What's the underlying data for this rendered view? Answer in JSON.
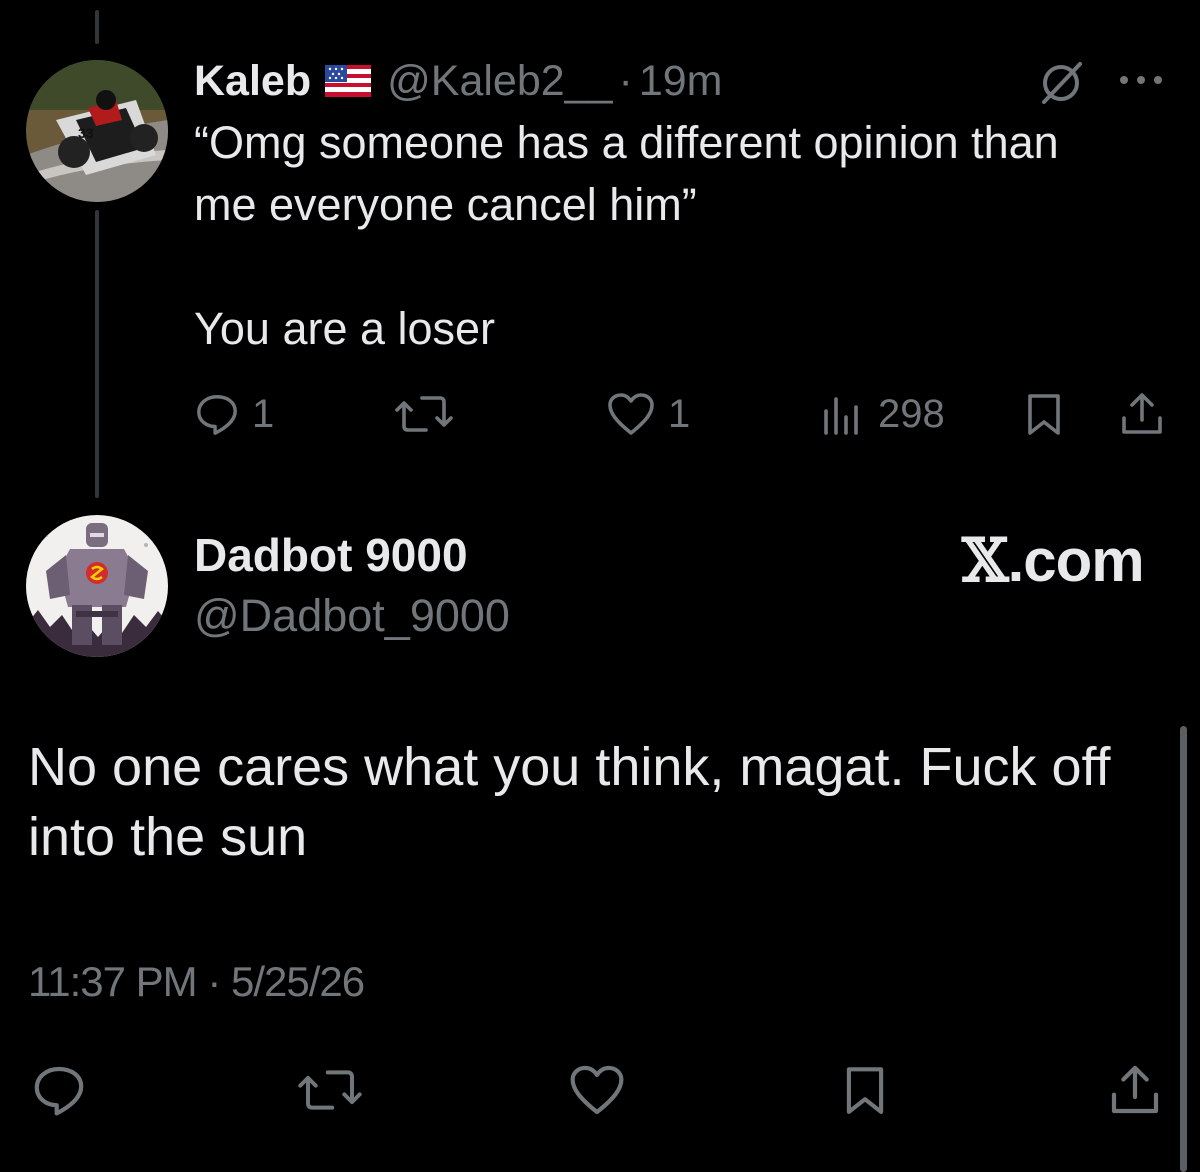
{
  "reply": {
    "author_name": "Kaleb",
    "flag_icon": "us-flag-icon",
    "handle": "@Kaleb2__",
    "separator": "·",
    "time": "19m",
    "text": "“Omg someone has a different opinion than\nme everyone cancel him”\n\nYou are a loser",
    "stats": {
      "replies": "1",
      "likes": "1",
      "views": "298"
    }
  },
  "post": {
    "author_name": "Dadbot 9000",
    "handle": "@Dadbot_9000",
    "text": "No one cares what you think, magat. Fuck off into the sun",
    "time": "11:37 PM",
    "separator": "·",
    "date": "5/25/26"
  },
  "watermark": {
    "x_letter": "𝕏",
    "suffix": ".com"
  },
  "colors": {
    "background": "#000000",
    "primary_text": "#e7e9ea",
    "secondary_text": "#71767b",
    "thread_line": "#333639"
  }
}
